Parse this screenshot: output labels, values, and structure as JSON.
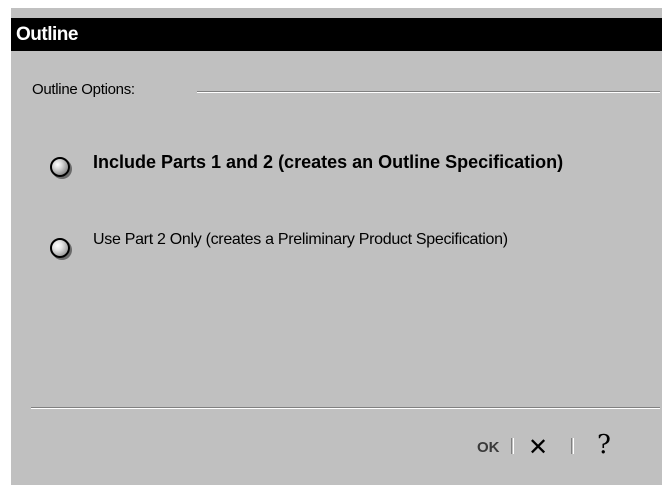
{
  "window": {
    "title": "Outline"
  },
  "group": {
    "label": "Outline Options:"
  },
  "options": [
    {
      "label": "Include Parts 1 and 2 (creates an Outline Specification)",
      "selected": false
    },
    {
      "label": "Use Part 2 Only (creates a Preliminary Product Specification)",
      "selected": false
    }
  ],
  "buttons": {
    "ok": "OK",
    "cancel_icon": "close-icon",
    "cancel_glyph": "✕",
    "help_icon": "help-icon",
    "help_glyph": "?"
  },
  "colors": {
    "dialog_background": "#c0c0c0",
    "titlebar_background": "#000000",
    "titlebar_text": "#ffffff"
  }
}
